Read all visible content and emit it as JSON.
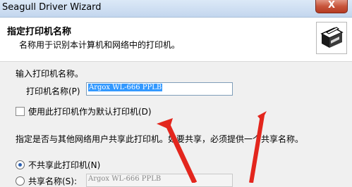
{
  "window": {
    "title": "Seagull Driver Wizard",
    "close_label": "X"
  },
  "header": {
    "title": "指定打印机名称",
    "subtitle": "名称用于识别本计算机和网络中的打印机。"
  },
  "name_section": {
    "prompt": "输入打印机名称。",
    "field_label": "打印机名称(P)",
    "field_value": "Argox WL-666 PPLB"
  },
  "default_printer": {
    "label": "使用此打印机作为默认打印机(D)",
    "checked": false
  },
  "sharing": {
    "description": "指定是否与其他网络用户共享此打印机。如要共享，必须提供一个共享名称。",
    "options": [
      {
        "label": "不共享此打印机(N)",
        "selected": true
      },
      {
        "label": "共享名称(S):",
        "selected": false
      }
    ],
    "share_name_value": "Argox WL-666 PPLB"
  },
  "colors": {
    "arrow": "#e3261d",
    "selection": "#3399ff"
  }
}
